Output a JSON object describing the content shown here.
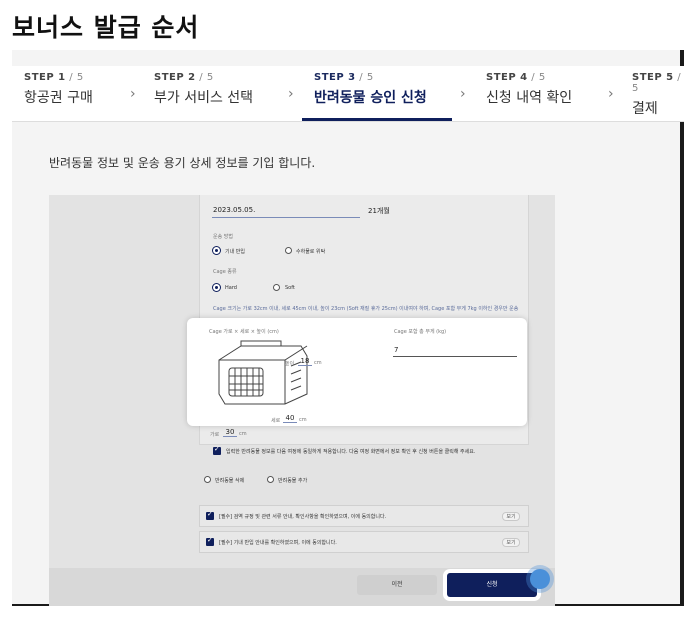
{
  "page_title": "보너스 발급 순서",
  "steps": [
    {
      "num": "STEP 1",
      "total": " / 5",
      "name": "항공권 구매"
    },
    {
      "num": "STEP 2",
      "total": " / 5",
      "name": "부가 서비스 선택"
    },
    {
      "num": "STEP 3",
      "total": " / 5",
      "name": "반려동물 승인 신청"
    },
    {
      "num": "STEP 4",
      "total": " / 5",
      "name": "신청 내역 확인"
    },
    {
      "num": "STEP 5",
      "total": " / 5",
      "name": "결제"
    }
  ],
  "chevron": "›",
  "instruction": "반려동물 정보 및 운송 용기 상세 정보를 기입 합니다.",
  "form": {
    "birth_date": "2023.05.05.",
    "age": "21개월",
    "transport_label": "운송 방법",
    "transport_options": [
      "기내 반입",
      "수하물로 위탁"
    ],
    "cage_type_label": "Cage 종류",
    "cage_options": [
      "Hard",
      "Soft"
    ],
    "cage_note": "Cage 크기는 가로 32cm 이내, 세로 45cm 이내, 높이 23cm (Soft 재질 휴가 25cm) 이내여야 하며, Cage 포함 무게 7kg 이하인 경우만 운송"
  },
  "popup": {
    "size_label": "Cage 가로 × 세로 × 높이 (cm)",
    "height_label": "높이",
    "height_value": "18",
    "depth_label": "세로",
    "depth_value": "40",
    "width_label": "가로",
    "width_value": "30",
    "unit": "cm",
    "weight_label": "Cage 포함 총 무게 (kg)",
    "weight_value": "7"
  },
  "confirm_text": "입력한 반려동물 정보를 다음 여정에 동일하게 적용합니다. 다음 여정 화면에서 정보 확인 후 신청 버튼을 클릭해 주세요.",
  "pet_actions": {
    "delete": "반려동물 삭제",
    "add": "반려동물 추가"
  },
  "agreements": [
    {
      "text": "[필수] 검역 규정 및 관련 서류 안내, 확인사항을 확인하였으며, 이에 동의합니다.",
      "view": "보기"
    },
    {
      "text": "[필수] 기내 반입 안내를 확인하였으며, 이에 동의합니다.",
      "view": "보기"
    }
  ],
  "buttons": {
    "prev": "이전",
    "apply": "신청"
  },
  "colors": {
    "accent": "#0f1f5c",
    "cursor": "#4a90d9"
  }
}
